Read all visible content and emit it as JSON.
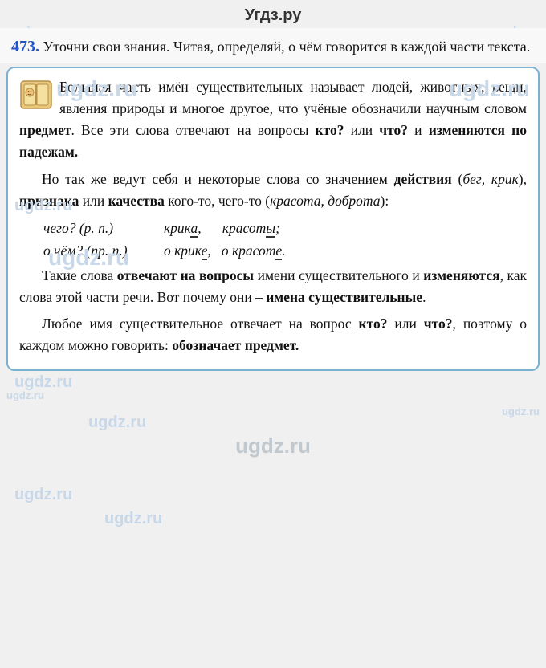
{
  "header": {
    "title": "Угдз.ру"
  },
  "task": {
    "number": "473.",
    "description": "Уточни свои знания. Читая, определяй, о чём говорится в каждой части текста."
  },
  "content": {
    "paragraph1": "Большая часть имён существительных называет людей, животных, вещи, явления природы и многое другое, что учёные обозначили научным словом предмет. Все эти слова отвечают на вопросы кто? или что? и изменяются по падежам.",
    "paragraph2": "Но так же ведут себя и некоторые слова со значением действия (бег, крик), признака или качества кого-то, чего-то (красота, доброта):",
    "case1_label": "чего? (р. п.)",
    "case1_words_1": "крик",
    "case1_words_1b": "а,",
    "case1_words_2": "красот",
    "case1_words_2b": "ы;",
    "case2_label": "о чём? (пр. п.)",
    "case2_words_1": "о крик",
    "case2_words_1b": "е,",
    "case2_words_2": "о красот",
    "case2_words_2b": "е.",
    "paragraph3": "Такие слова отвечают на вопросы имени существительного и изменяются, как слова этой части речи. Вот почему они – имена существительные.",
    "paragraph4": "Любое имя существительное отвечает на вопрос кто? или что?, поэтому о каждом можно говорить: обозначает предмет.",
    "watermarks": [
      "ugdz.ru",
      "ugdz.ru",
      "ugdz.ru",
      "ugdz.ru",
      "ugdz.ru",
      "ugdz.ru",
      "ugdz.ru",
      "ugdz.ru",
      "ugdz.ru",
      "ugdz.ru"
    ]
  }
}
